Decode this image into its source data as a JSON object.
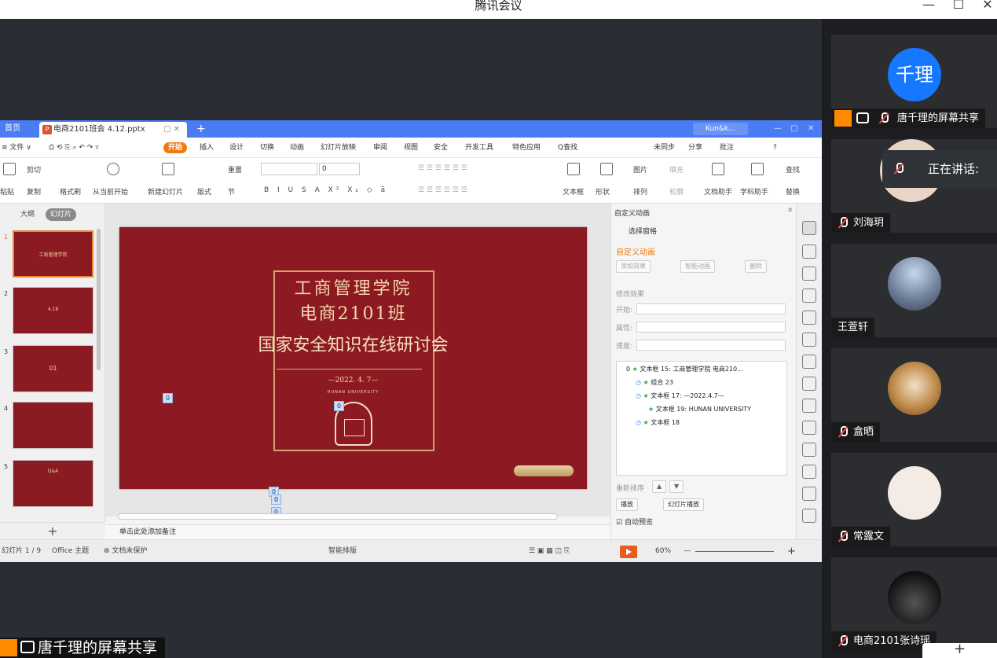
{
  "window": {
    "title": "腾讯会议",
    "minimize": "—",
    "maximize": "☐",
    "close": "✕"
  },
  "wps": {
    "tabs": {
      "home": "首页",
      "file": "电商2101班会 4.12.pptx",
      "plus": "+",
      "account": "Kun&k..."
    },
    "menu": {
      "items": [
        "≡ 文件 ∨",
        "开始",
        "插入",
        "设计",
        "切换",
        "动画",
        "幻灯片放映",
        "审阅",
        "视图",
        "安全",
        "开发工具",
        "特色应用",
        "Q查找"
      ],
      "right": [
        "未同步",
        "分享",
        "批注",
        "?"
      ]
    },
    "ribbon": {
      "paste": "粘贴",
      "cut": "剪切",
      "copy": "复制",
      "format_painter": "格式刷",
      "play_from_current": "从当前开始",
      "new_slide": "新建幻灯片",
      "layout": "版式",
      "section": "节",
      "reset": "重置",
      "font_size": "0",
      "textbox": "文本框",
      "shape": "形状",
      "picture": "图片",
      "arrange": "排列",
      "fill": "填充",
      "outline": "轮廓",
      "doc_assistant": "文档助手",
      "study_assistant": "学科助手",
      "find": "查找",
      "replace": "替换"
    },
    "left_panel": {
      "tab_outline": "大纲",
      "tab_slides": "幻灯片",
      "slide_numbers": [
        "1",
        "2",
        "3",
        "4",
        "5"
      ],
      "thumb_texts": [
        "工商管理学院",
        "4.18",
        "01",
        "",
        "Q&A"
      ],
      "add": "+"
    },
    "slide": {
      "line1": "工商管理学院",
      "line2": "电商2101班",
      "line3": "国家安全知识在线研讨会",
      "date": "—2022. 4. 7—",
      "university": "HUNAN UNIVERSITY",
      "tags": [
        "0",
        "0",
        "0",
        "0",
        "0"
      ]
    },
    "notes_placeholder": "单击此处添加备注",
    "anim_pane": {
      "header": "自定义动画",
      "select_pane": "选择窗格",
      "section_title": "自定义动画",
      "add_effect": "添加效果",
      "smart_anim": "智能动画",
      "delete": "删除",
      "modify": "修改效果",
      "start_label": "开始:",
      "property_label": "属性:",
      "speed_label": "速度:",
      "items": [
        {
          "index": "0",
          "label": "文本框 15: 工商管理学院 电商210..."
        },
        {
          "index": "",
          "label": "组合 23"
        },
        {
          "index": "",
          "label": "文本框 17: —2022.4.7—"
        },
        {
          "index": "",
          "label": "文本框 19: HUNAN UNIVERSITY"
        },
        {
          "index": "",
          "label": "文本框 18"
        }
      ],
      "reorder": "重新排序",
      "play": "播放",
      "slideshow": "幻灯片播放",
      "autopreview": "自动预览"
    },
    "status": {
      "slide_count": "幻灯片 1 / 9",
      "theme": "Office 主题",
      "protection": "文档未保护",
      "smart_layout": "智能排版",
      "zoom": "60%",
      "minus": "—",
      "plus": "+"
    }
  },
  "participants": [
    {
      "name": "唐千理的屏幕共享",
      "avatar_text": "千理",
      "avatar_color": "#1677ff"
    },
    {
      "name": "刘海玥",
      "avatar_text": ""
    },
    {
      "name": "王萱轩",
      "avatar_text": ""
    },
    {
      "name": "盒晒",
      "avatar_text": ""
    },
    {
      "name": "常露文",
      "avatar_text": ""
    },
    {
      "name": "电商2101张诗瑶",
      "avatar_text": ""
    }
  ],
  "speaking": "正在讲话:",
  "share_badge": "唐千理的屏幕共享",
  "corner": "+"
}
